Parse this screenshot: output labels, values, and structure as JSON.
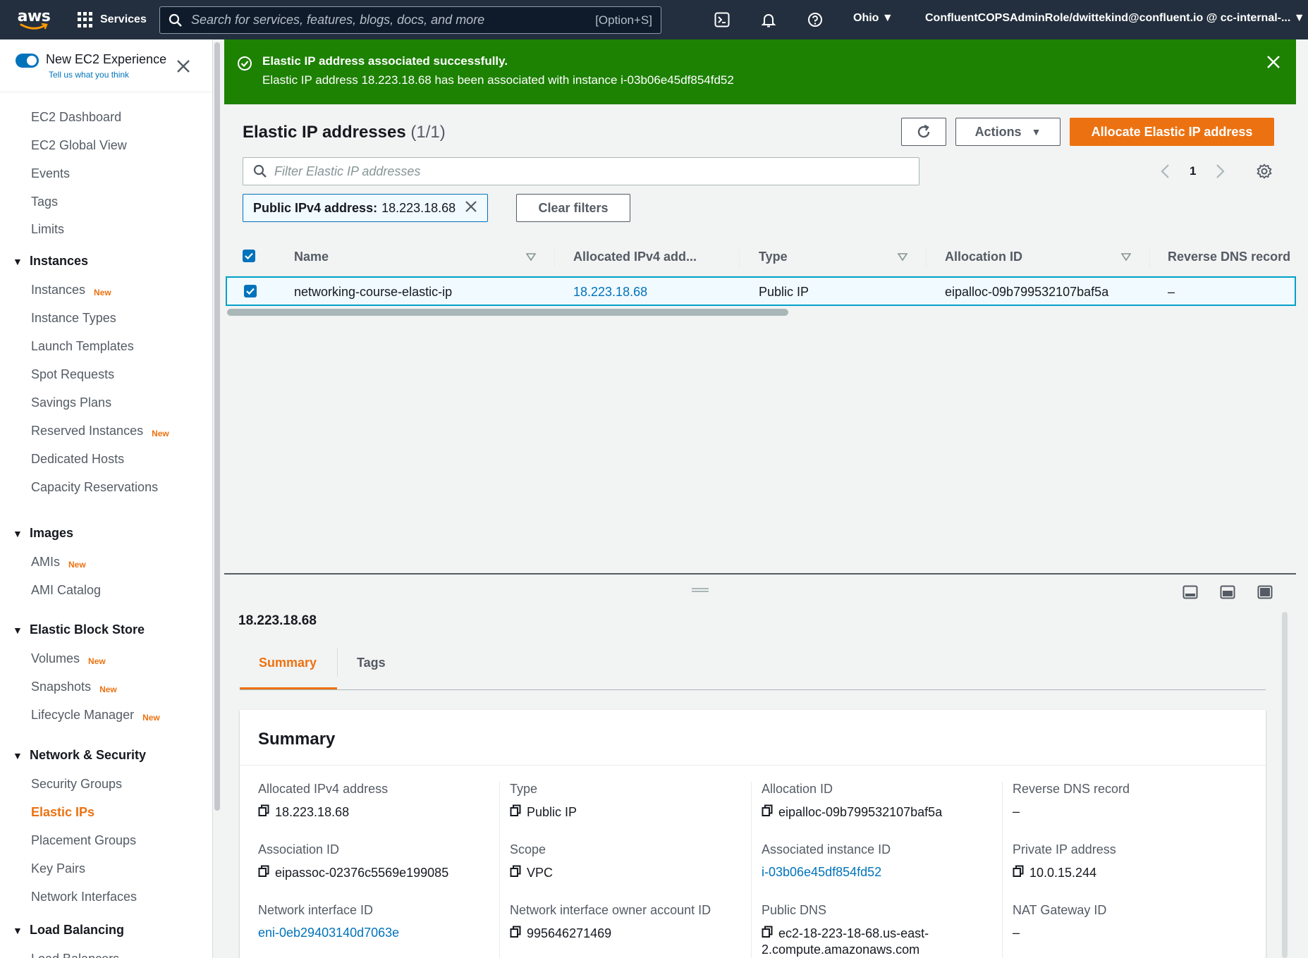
{
  "topnav": {
    "logo": "aws",
    "services_label": "Services",
    "search_placeholder": "Search for services, features, blogs, docs, and more",
    "search_shortcut": "[Option+S]",
    "region": "Ohio",
    "account": "ConfluentCOPSAdminRole/dwittekind@confluent.io @ cc-internal-...",
    "icons": [
      "cloudshell-icon",
      "bell-icon",
      "help-icon"
    ]
  },
  "sidebar": {
    "toggle_title": "New EC2 Experience",
    "toggle_subtitle": "Tell us what you think",
    "new_badge": "New",
    "top_items": [
      "EC2 Dashboard",
      "EC2 Global View",
      "Events",
      "Tags",
      "Limits"
    ],
    "sections": [
      {
        "title": "Instances",
        "items": [
          {
            "label": "Instances",
            "new": true
          },
          {
            "label": "Instance Types",
            "new": false
          },
          {
            "label": "Launch Templates",
            "new": false
          },
          {
            "label": "Spot Requests",
            "new": false
          },
          {
            "label": "Savings Plans",
            "new": false
          },
          {
            "label": "Reserved Instances",
            "new": true
          },
          {
            "label": "Dedicated Hosts",
            "new": false
          },
          {
            "label": "Capacity Reservations",
            "new": false
          }
        ]
      },
      {
        "title": "Images",
        "items": [
          {
            "label": "AMIs",
            "new": true
          },
          {
            "label": "AMI Catalog",
            "new": false
          }
        ]
      },
      {
        "title": "Elastic Block Store",
        "items": [
          {
            "label": "Volumes",
            "new": true
          },
          {
            "label": "Snapshots",
            "new": true
          },
          {
            "label": "Lifecycle Manager",
            "new": true
          }
        ]
      },
      {
        "title": "Network & Security",
        "items": [
          {
            "label": "Security Groups",
            "new": false
          },
          {
            "label": "Elastic IPs",
            "new": false,
            "active": true
          },
          {
            "label": "Placement Groups",
            "new": false
          },
          {
            "label": "Key Pairs",
            "new": false
          },
          {
            "label": "Network Interfaces",
            "new": false
          }
        ]
      },
      {
        "title": "Load Balancing",
        "items": [
          {
            "label": "Load Balancers",
            "new": false
          }
        ]
      }
    ]
  },
  "flash": {
    "title": "Elastic IP address associated successfully.",
    "message": "Elastic IP address 18.223.18.68 has been associated with instance i-03b06e45df854fd52",
    "color": "#1d8102"
  },
  "table_panel": {
    "title": "Elastic IP addresses",
    "count": "(1/1)",
    "actions_label": "Actions",
    "allocate_label": "Allocate Elastic IP address",
    "filter_placeholder": "Filter Elastic IP addresses",
    "page_number": "1",
    "filter_token_key": "Public IPv4 address:",
    "filter_token_value": "18.223.18.68",
    "clear_filters_label": "Clear filters",
    "columns": [
      "Name",
      "Allocated IPv4 add...",
      "Type",
      "Allocation ID",
      "Reverse DNS record"
    ],
    "rows": [
      {
        "name": "networking-course-elastic-ip",
        "ipv4": "18.223.18.68",
        "type": "Public IP",
        "allocation_id": "eipalloc-09b799532107baf5a",
        "reverse_dns": "–",
        "selected": true
      }
    ]
  },
  "detail": {
    "title": "18.223.18.68",
    "tabs": [
      "Summary",
      "Tags"
    ],
    "active_tab": "Summary",
    "summary_title": "Summary",
    "fields": [
      {
        "label": "Allocated IPv4 address",
        "value": "18.223.18.68",
        "copy": true,
        "link": false
      },
      {
        "label": "Type",
        "value": "Public IP",
        "copy": true,
        "link": false
      },
      {
        "label": "Allocation ID",
        "value": "eipalloc-09b799532107baf5a",
        "copy": true,
        "link": false
      },
      {
        "label": "Reverse DNS record",
        "value": "–",
        "copy": false,
        "link": false
      },
      {
        "label": "Association ID",
        "value": "eipassoc-02376c5569e199085",
        "copy": true,
        "link": false
      },
      {
        "label": "Scope",
        "value": "VPC",
        "copy": true,
        "link": false
      },
      {
        "label": "Associated instance ID",
        "value": "i-03b06e45df854fd52",
        "copy": false,
        "link": true
      },
      {
        "label": "Private IP address",
        "value": "10.0.15.244",
        "copy": true,
        "link": false
      },
      {
        "label": "Network interface ID",
        "value": "eni-0eb29403140d7063e",
        "copy": false,
        "link": true
      },
      {
        "label": "Network interface owner account ID",
        "value": "995646271469",
        "copy": true,
        "link": false
      },
      {
        "label": "Public DNS",
        "value": "ec2-18-223-18-68.us-east-",
        "value2": "2.compute.amazonaws.com",
        "copy": true,
        "link": false
      },
      {
        "label": "NAT Gateway ID",
        "value": "–",
        "copy": false,
        "link": false
      }
    ]
  },
  "colors": {
    "nav": "#232f3e",
    "accent": "#ec7211",
    "link": "#0073bb",
    "success": "#1d8102"
  }
}
